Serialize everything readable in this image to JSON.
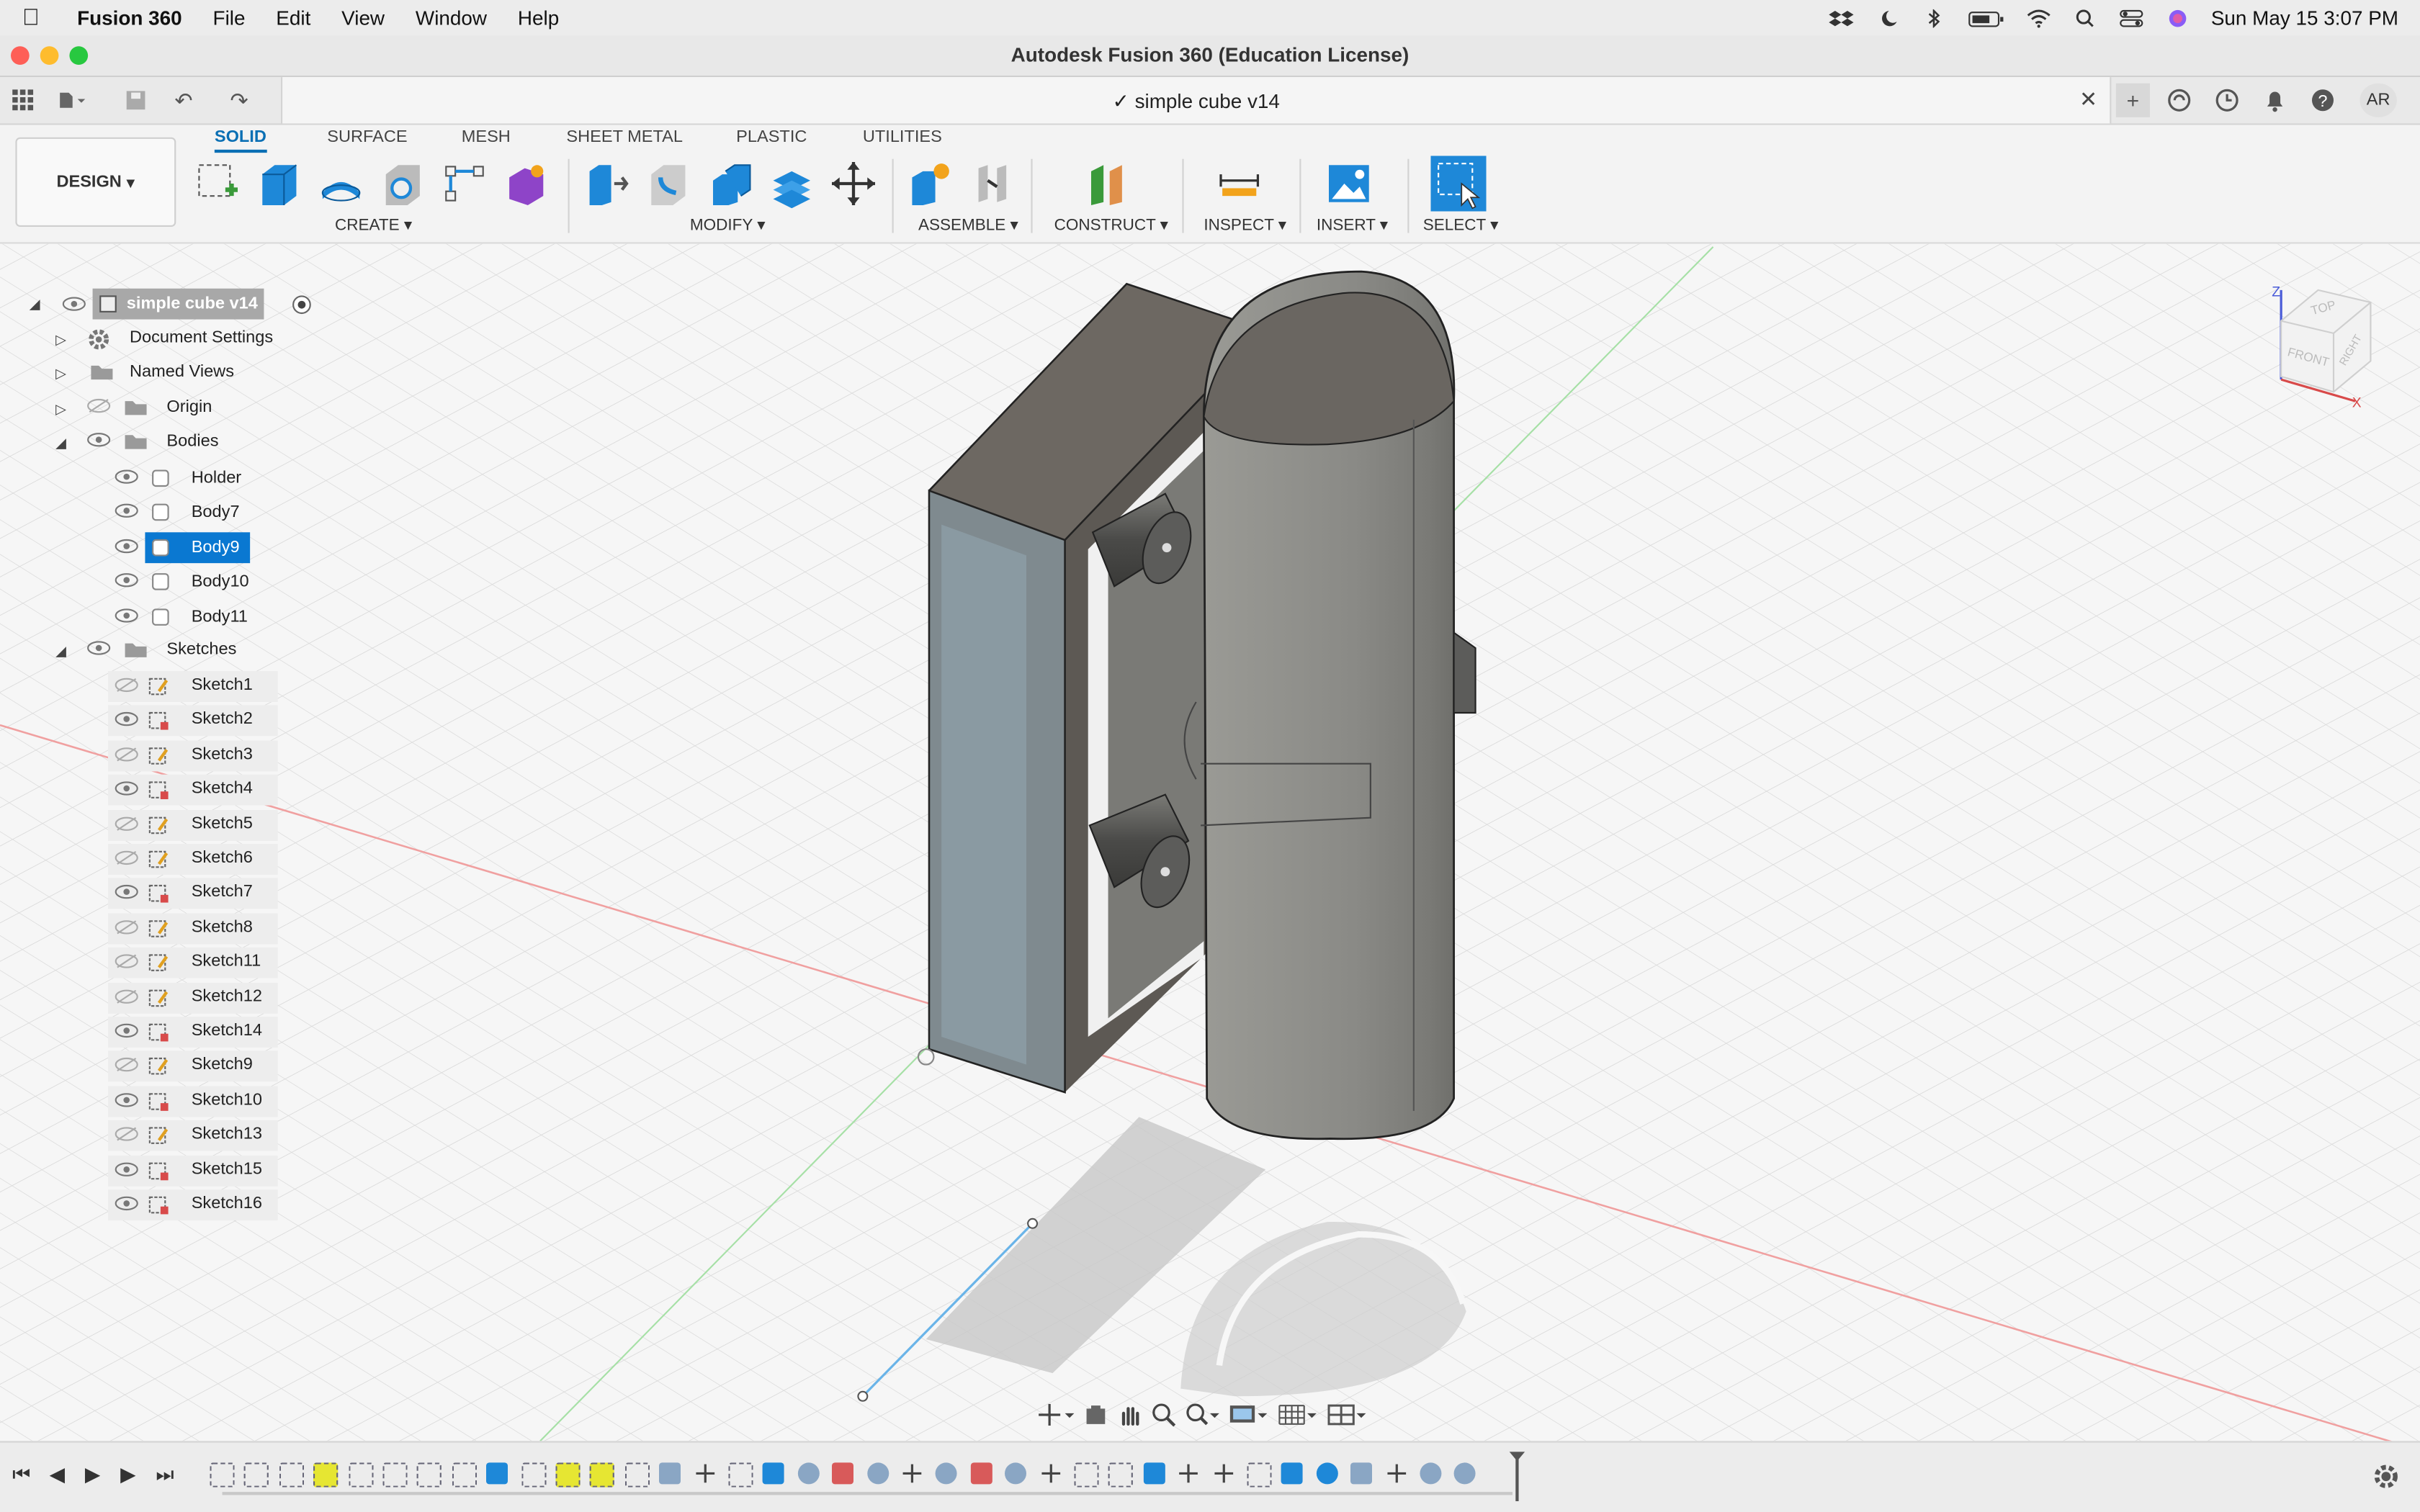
{
  "menubar": {
    "app": "Fusion 360",
    "items": [
      "File",
      "Edit",
      "View",
      "Window",
      "Help"
    ],
    "datetime": "Sun May 15  3:07 PM"
  },
  "window": {
    "title": "Autodesk Fusion 360 (Education License)"
  },
  "document": {
    "tab_title": "simple cube v14",
    "user_initials": "AR"
  },
  "toolbar": {
    "workspace": "DESIGN",
    "tabs": [
      "SOLID",
      "SURFACE",
      "MESH",
      "SHEET METAL",
      "PLASTIC",
      "UTILITIES"
    ],
    "active_tab": "SOLID",
    "groups": [
      "CREATE",
      "MODIFY",
      "ASSEMBLE",
      "CONSTRUCT",
      "INSPECT",
      "INSERT",
      "SELECT"
    ]
  },
  "browser": {
    "root": "simple cube v14",
    "top_items": [
      "Document Settings",
      "Named Views",
      "Origin",
      "Bodies"
    ],
    "bodies": [
      "Holder",
      "Body7",
      "Body9",
      "Body10",
      "Body11"
    ],
    "selected_body": "Body9",
    "sketches_label": "Sketches",
    "sketches": [
      "Sketch1",
      "Sketch2",
      "Sketch3",
      "Sketch4",
      "Sketch5",
      "Sketch6",
      "Sketch7",
      "Sketch8",
      "Sketch11",
      "Sketch12",
      "Sketch14",
      "Sketch9",
      "Sketch10",
      "Sketch13",
      "Sketch15",
      "Sketch16"
    ]
  },
  "viewcube": {
    "top": "TOP",
    "front": "FRONT",
    "right": "RIGHT",
    "axis_z": "Z",
    "axis_x": "X"
  },
  "colors": {
    "accent": "#0a78d1",
    "grid": "#d9d9d9",
    "body_gray": "#8a8a86"
  }
}
